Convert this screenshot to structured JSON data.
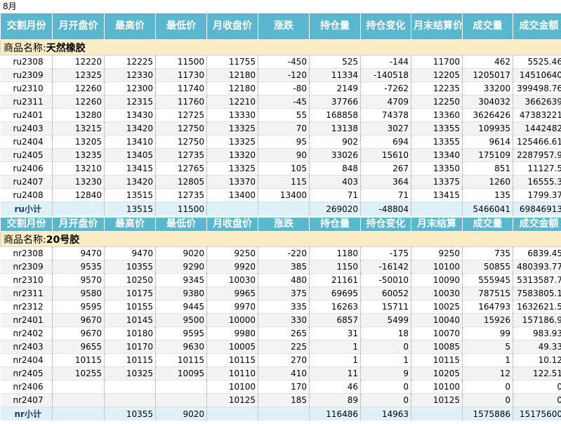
{
  "sheet_title": "8月",
  "header1": [
    "交割月份",
    "月开盘价",
    "最高价",
    "最低价",
    "月收盘价",
    "涨跌",
    "持仓量",
    "持仓变化",
    "月末结算价",
    "成交量",
    "成交金额"
  ],
  "header2": [
    "交割月份",
    "月开盘价",
    "最高价",
    "最低价",
    "月收盘价",
    "涨跌",
    "持仓量",
    "持仓变化",
    "月末结算",
    "成交量",
    "成交金额"
  ],
  "group1": {
    "prefix": "商品名称:",
    "name": "天然橡胶"
  },
  "group2": {
    "prefix": "商品名称:",
    "name": "20号胶"
  },
  "rows1": [
    [
      "ru2308",
      "12220",
      "12225",
      "11500",
      "11755",
      "-450",
      "525",
      "-144",
      "11700",
      "462",
      "5525.46"
    ],
    [
      "ru2309",
      "12325",
      "12330",
      "11730",
      "12180",
      "-120",
      "11334",
      "-140518",
      "12205",
      "1205017",
      "14510640"
    ],
    [
      "ru2310",
      "12260",
      "12300",
      "11740",
      "12180",
      "-80",
      "2149",
      "-7262",
      "12235",
      "33200",
      "399498.76"
    ],
    [
      "ru2311",
      "12260",
      "12315",
      "11760",
      "12210",
      "-45",
      "37766",
      "4709",
      "12250",
      "304032",
      "3662639"
    ],
    [
      "ru2401",
      "13280",
      "13430",
      "12725",
      "13330",
      "55",
      "168858",
      "74378",
      "13360",
      "3626426",
      "47383221"
    ],
    [
      "ru2403",
      "13215",
      "13420",
      "12750",
      "13325",
      "70",
      "13138",
      "3027",
      "13355",
      "109935",
      "1442482"
    ],
    [
      "ru2404",
      "13205",
      "13410",
      "12750",
      "13325",
      "95",
      "902",
      "694",
      "13355",
      "9614",
      "125466.61"
    ],
    [
      "ru2405",
      "13235",
      "13405",
      "12735",
      "13320",
      "90",
      "33026",
      "15610",
      "13340",
      "175109",
      "2287957.9"
    ],
    [
      "ru2406",
      "13210",
      "13415",
      "12765",
      "13325",
      "105",
      "848",
      "267",
      "13350",
      "851",
      "11127.5"
    ],
    [
      "ru2407",
      "13230",
      "13420",
      "12805",
      "13370",
      "115",
      "403",
      "364",
      "13375",
      "1260",
      "16555.3"
    ],
    [
      "ru2408",
      "12840",
      "13515",
      "12735",
      "13400",
      "13400",
      "71",
      "71",
      "13415",
      "135",
      "1799.37"
    ]
  ],
  "subtotal1": [
    "ru小计",
    "",
    "13515",
    "11500",
    "",
    "",
    "269020",
    "-48804",
    "",
    "5466041",
    "69846913"
  ],
  "rows2": [
    [
      "nr2308",
      "9470",
      "9470",
      "9020",
      "9250",
      "-220",
      "1180",
      "-175",
      "9250",
      "735",
      "6839.45"
    ],
    [
      "nr2309",
      "9535",
      "10355",
      "9290",
      "9920",
      "385",
      "1150",
      "-16142",
      "10100",
      "50855",
      "480393.77"
    ],
    [
      "nr2310",
      "9570",
      "10250",
      "9345",
      "10030",
      "480",
      "21161",
      "-50010",
      "10090",
      "555945",
      "5313587.7"
    ],
    [
      "nr2311",
      "9580",
      "10175",
      "9380",
      "9965",
      "375",
      "69695",
      "60052",
      "10030",
      "787515",
      "7583805.1"
    ],
    [
      "nr2312",
      "9595",
      "10155",
      "9445",
      "9970",
      "335",
      "16263",
      "15711",
      "10025",
      "164793",
      "1632621.5"
    ],
    [
      "nr2401",
      "9670",
      "10145",
      "9500",
      "10000",
      "330",
      "6857",
      "5499",
      "10040",
      "15926",
      "157186.9"
    ],
    [
      "nr2402",
      "9670",
      "10180",
      "9595",
      "9980",
      "265",
      "31",
      "18",
      "10070",
      "99",
      "983.93"
    ],
    [
      "nr2403",
      "9655",
      "10170",
      "9630",
      "10005",
      "225",
      "1",
      "0",
      "10085",
      "5",
      "49.33"
    ],
    [
      "nr2404",
      "10115",
      "10115",
      "10115",
      "10115",
      "270",
      "1",
      "1",
      "10115",
      "1",
      "10.12"
    ],
    [
      "nr2405",
      "10255",
      "10325",
      "10095",
      "10110",
      "410",
      "11",
      "9",
      "10205",
      "12",
      "122.51"
    ],
    [
      "nr2406",
      "",
      "",
      "",
      "10100",
      "170",
      "46",
      "0",
      "10100",
      "0",
      "0"
    ],
    [
      "nr2407",
      "",
      "",
      "",
      "10125",
      "185",
      "89",
      "0",
      "10125",
      "0",
      "0"
    ]
  ],
  "subtotal2": [
    "nr小计",
    "",
    "10355",
    "9020",
    "",
    "",
    "116486",
    "14963",
    "",
    "1575886",
    "15175600"
  ]
}
